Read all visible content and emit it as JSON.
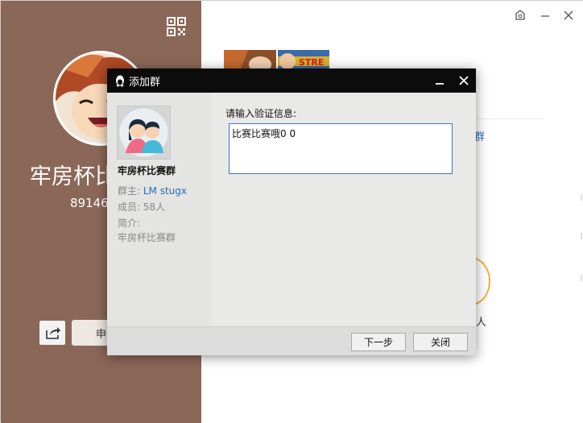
{
  "background_window": {
    "group_title": "牢房杯比赛群",
    "group_id": "891463",
    "apply_label": "申请加群",
    "right_link_fragment": "群",
    "right_text_fragment": "人"
  },
  "dialog": {
    "title": "添加群",
    "group_name": "牢房杯比赛群",
    "owner_label": "群主:",
    "owner_value": "LM stugx",
    "members_label": "成员:",
    "members_value": "58人",
    "intro_label": "简介:",
    "intro_value": "牢房杯比赛群",
    "verify_label": "请输入验证信息:",
    "verify_value": "比赛比赛哦0 0",
    "next_label": "下一步",
    "close_label": "关闭"
  },
  "icons": {
    "qr": "qr-code-icon",
    "share": "share-icon",
    "penguin": "qq-penguin-icon",
    "minimize": "minimize-icon",
    "close": "close-icon"
  },
  "colors": {
    "left_panel": "#8b6758",
    "titlebar": "#0c0c0c",
    "link": "#2a6ebc",
    "input_border": "#3b78c6"
  }
}
